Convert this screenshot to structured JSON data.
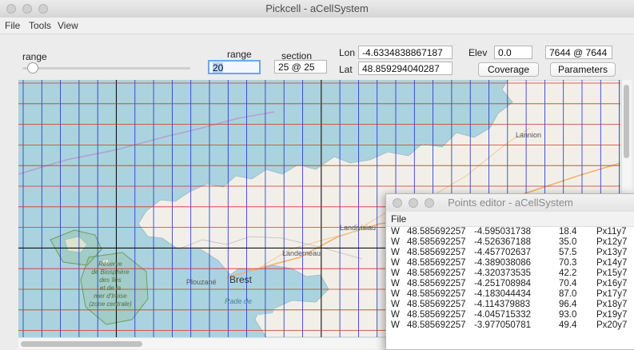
{
  "window": {
    "title": "Pickcell - aCellSystem"
  },
  "menu": [
    "File",
    "Tools",
    "View"
  ],
  "toolbar": {
    "range_slider_label": "range",
    "range_slider_value_pct": 5,
    "range_label": "range",
    "range_value": "20",
    "section_label": "section",
    "section_value": "25 @ 25",
    "lon_label": "Lon",
    "lon_value": "-4.6334838867187",
    "lat_label": "Lat",
    "lat_value": "48.859294040287",
    "elev_label": "Elev",
    "elev_value": "0.0",
    "cell_value": "7644 @ 7644",
    "coverage_button": "Coverage",
    "parameters_button": "Parameters"
  },
  "map": {
    "labels": {
      "lannion": "Lannion",
      "landivisiau": "Landivisiau",
      "landerneau": "Landerneau",
      "brest": "Brest",
      "plouzane": "Plouzané",
      "rade": "Rade de",
      "reserve": [
        "Réserve",
        "de Biosphère",
        "des îles",
        "et de la",
        "mer d'Iroise",
        "(zone centrale)"
      ]
    },
    "colors": {
      "sea": "#aad3df",
      "land": "#f2efe9",
      "grid_h": "#d9302b",
      "grid_v": "#1d2fd0"
    }
  },
  "points_editor": {
    "title": "Points editor - aCellSystem",
    "menu": [
      "File"
    ],
    "rows": [
      [
        "W",
        "48.585692257",
        "-4.595031738",
        "18.4",
        "Px11y7"
      ],
      [
        "W",
        "48.585692257",
        "-4.526367188",
        "35.0",
        "Px12y7"
      ],
      [
        "W",
        "48.585692257",
        "-4.457702637",
        "57.5",
        "Px13y7"
      ],
      [
        "W",
        "48.585692257",
        "-4.389038086",
        "70.3",
        "Px14y7"
      ],
      [
        "W",
        "48.585692257",
        "-4.320373535",
        "42.2",
        "Px15y7"
      ],
      [
        "W",
        "48.585692257",
        "-4.251708984",
        "70.4",
        "Px16y7"
      ],
      [
        "W",
        "48.585692257",
        "-4.183044434",
        "87.0",
        "Px17y7"
      ],
      [
        "W",
        "48.585692257",
        "-4.114379883",
        "96.4",
        "Px18y7"
      ],
      [
        "W",
        "48.585692257",
        "-4.045715332",
        "93.0",
        "Px19y7"
      ],
      [
        "W",
        "48.585692257",
        "-3.977050781",
        "49.4",
        "Px20y7"
      ]
    ]
  }
}
